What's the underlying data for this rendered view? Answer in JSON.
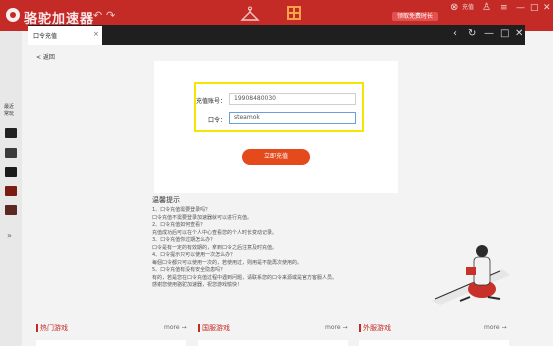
{
  "app": {
    "title": "骆驼加速器",
    "back_arrow": "↶",
    "refresh_arrow": "↷",
    "free_btn": "领取免费时长",
    "recharge_label": "充值",
    "win_menu": "≡",
    "win_min": "—",
    "win_max": "□",
    "win_close": "✕",
    "accent_color": "#c42a26"
  },
  "browser": {
    "tab_label": "口令充值",
    "tab_close": "×",
    "ctrl_back": "‹",
    "ctrl_refresh": "↻",
    "ctrl_min": "—",
    "ctrl_max": "□",
    "ctrl_close": "✕"
  },
  "sidebar": {
    "recent_line1": "最近",
    "recent_line2": "常玩",
    "expand_icon": "chevron-down-icon",
    "expand_glyph": "»"
  },
  "page": {
    "back_label": "< 返回",
    "account_label": "充值账号：",
    "account_value": "19908480030",
    "code_label": "口令：",
    "code_value": "steamok",
    "submit_label": "立即充值",
    "highlight_color": "#f3e600",
    "submit_color": "#e44a1c"
  },
  "tips": {
    "title": "温馨提示",
    "lines": [
      "1、口令充值需要登录吗？",
      "口令充值不需要登录加速器就可以进行充值。",
      "2、口令充值如何查看？",
      "充值成功后可以在个人中心查看您的个人时长变动记录。",
      "3、口令充值你过期怎么办？",
      "口令是有一定的有效期的，拿到口令之后注意及时充值。",
      "4、口令提示只可以使用一次怎么办？",
      "每個口令都只可以使用一次的，若使用过，则用是不能再次使用的。",
      "5、口令充值有没有安全隐患吗？",
      "有的，若是您在口令充值过程中遇到问题，请联系您的口令来源或是官方客服人员。",
      "感谢您使用骆驼加速器，祝您游戏愉快！"
    ]
  },
  "sections": [
    {
      "title": "热门游戏",
      "more": "more →"
    },
    {
      "title": "国服游戏",
      "more": "more →"
    },
    {
      "title": "外服游戏",
      "more": "more →"
    }
  ]
}
